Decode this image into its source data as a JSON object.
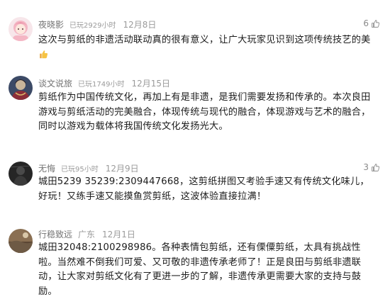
{
  "comments": [
    {
      "username": "夜晓影",
      "badge": "已玩2929小时",
      "date": "12月8日",
      "likes": "6",
      "text": "这次与剪纸的非遗活动联动真的很有意义，让广大玩家见识到这项传统技艺的美",
      "emoji": "thumbs-up-emoji"
    },
    {
      "username": "谈文说旅",
      "badge": "已玩1749小时",
      "date": "12月15日",
      "likes": "",
      "text": "剪纸作为中国传统文化，再加上有是非遗，是我们需要发扬和传承的。本次良田游戏与剪纸活动的完美融合，体现传统与现代的融合，体现游戏与艺术的融合，同时以游戏为载体将我国传统文化发扬光大。"
    },
    {
      "username": "无悔",
      "badge": "已玩95小时",
      "date": "12月9日",
      "likes": "3",
      "text": "城田5239 35239:2309447668，这剪纸拼图又考验手速又有传统文化味儿，好玩！又练手速又能摸鱼赏剪纸，这波体验直接拉满！"
    },
    {
      "username": "行稳致远",
      "badge": "广东",
      "date": "12月1日",
      "likes": "",
      "text": "城田32048:2100298986。各种表情包剪纸，还有傈僳剪纸，太具有挑战性啦。当然难不倒我们可爱、又可敬的非遗传承老师了！正是良田与剪纸非遗联动，让大家对剪纸文化有了更进一步的了解，非遗传承更需要大家的支持与鼓励。"
    }
  ],
  "colors": {
    "username": "#737373",
    "meta": "#9b9b9b",
    "text": "#1c1c1c"
  }
}
